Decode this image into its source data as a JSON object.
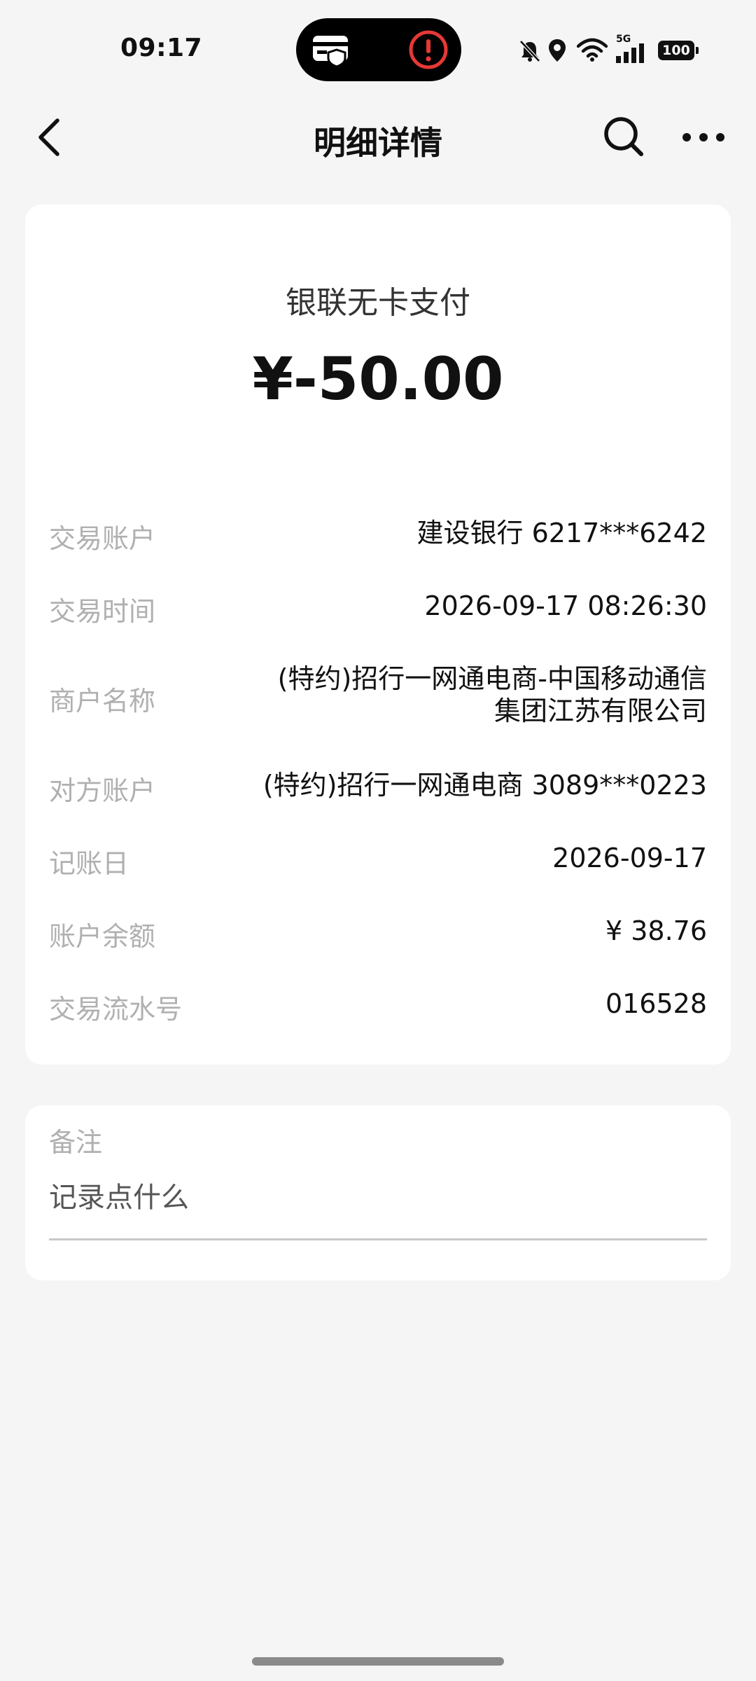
{
  "status_bar": {
    "time": "09:17",
    "network": "5G",
    "battery": "100",
    "icons": [
      "wallet-card-icon",
      "alert-icon",
      "bell-off-icon",
      "location-icon",
      "wifi-icon",
      "signal-icon",
      "battery-icon"
    ]
  },
  "nav": {
    "title": "明细详情",
    "icons": [
      "back-icon",
      "search-icon",
      "more-icon"
    ]
  },
  "transaction": {
    "type": "银联无卡支付",
    "amount": "¥-50.00",
    "rows": [
      {
        "label": "交易账户",
        "value": "建设银行 6217***6242"
      },
      {
        "label": "交易时间",
        "value": "2026-09-17 08:26:30"
      },
      {
        "label": "商户名称",
        "value_line1": "(特约)招行一网通电商-中国移动通信",
        "value_line2": "集团江苏有限公司"
      },
      {
        "label": "对方账户",
        "value": "(特约)招行一网通电商 3089***0223"
      },
      {
        "label": "记账日",
        "value": "2026-09-17"
      },
      {
        "label": "账户余额",
        "value": "¥ 38.76"
      },
      {
        "label": "交易流水号",
        "value": "016528"
      }
    ]
  },
  "note": {
    "label": "备注",
    "placeholder": "记录点什么"
  },
  "colors": {
    "background": "#f5f5f5",
    "card": "#ffffff",
    "label": "#b0b0b0",
    "alert": "#e53935"
  }
}
